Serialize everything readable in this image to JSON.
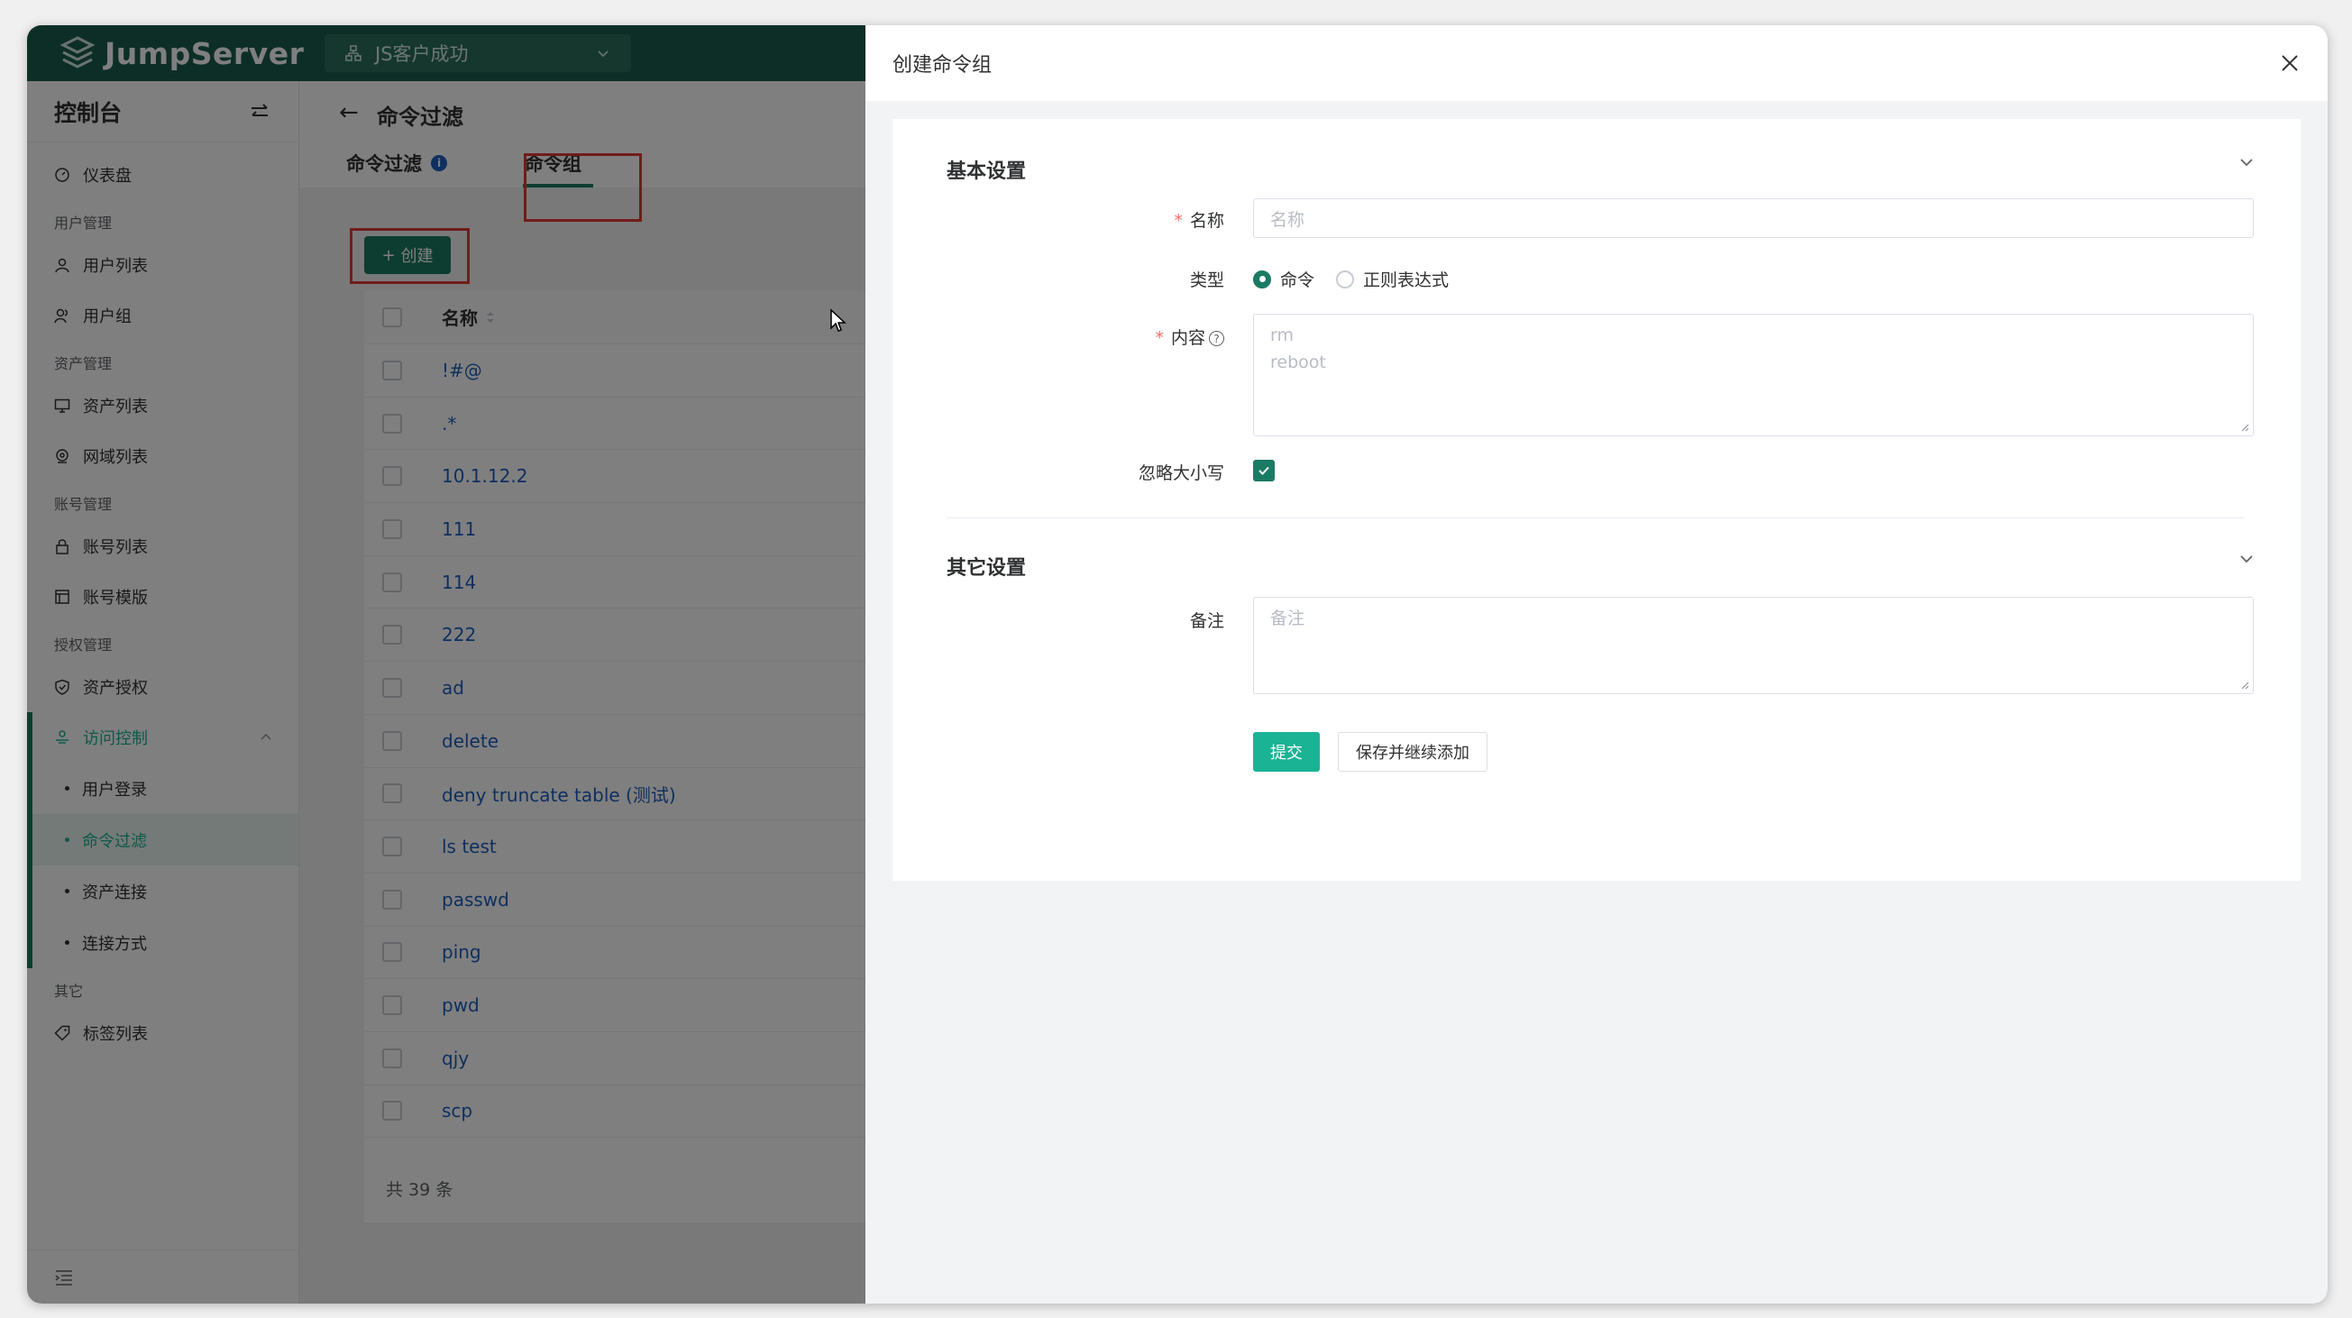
{
  "app": {
    "logo_text": "JumpServer",
    "org": "JS客户成功"
  },
  "sidebar": {
    "title": "控制台",
    "dashboard": "仪表盘",
    "groups": {
      "user_mgmt": "用户管理",
      "asset_mgmt": "资产管理",
      "account_mgmt": "账号管理",
      "perm_mgmt": "授权管理",
      "other": "其它"
    },
    "items": {
      "user_list": "用户列表",
      "user_group": "用户组",
      "asset_list": "资产列表",
      "domain_list": "网域列表",
      "account_list": "账号列表",
      "account_template": "账号模版",
      "asset_perm": "资产授权",
      "access_control": "访问控制",
      "user_login": "用户登录",
      "cmd_filter": "命令过滤",
      "asset_connect": "资产连接",
      "connect_method": "连接方式",
      "label_list": "标签列表"
    }
  },
  "page": {
    "title": "命令过滤",
    "tabs": [
      "命令过滤",
      "命令组"
    ],
    "tab_info": "i",
    "create_button": "创建",
    "table": {
      "header_name": "名称",
      "rows": [
        "!#@",
        ".*",
        "10.1.12.2",
        "111",
        "114",
        "222",
        "ad",
        "delete",
        "deny truncate table (测试)",
        "ls test",
        "passwd",
        "ping",
        "pwd",
        "qjy",
        "scp"
      ],
      "footer": "共 39 条"
    }
  },
  "drawer": {
    "title": "创建命令组",
    "basic_section": "基本设置",
    "name_label": "名称",
    "name_placeholder": "名称",
    "type_label": "类型",
    "type_options": [
      "命令",
      "正则表达式"
    ],
    "content_label": "内容",
    "content_placeholder_line1": "rm",
    "content_placeholder_line2": "reboot",
    "ignore_case_label": "忽略大小写",
    "other_section": "其它设置",
    "comment_label": "备注",
    "comment_placeholder": "备注",
    "submit_button": "提交",
    "save_continue_button": "保存并继续添加"
  },
  "colors": {
    "brand": "#1a5d4d",
    "accent": "#1ab394",
    "link": "#1f5fbf",
    "highlight": "#e53935"
  }
}
